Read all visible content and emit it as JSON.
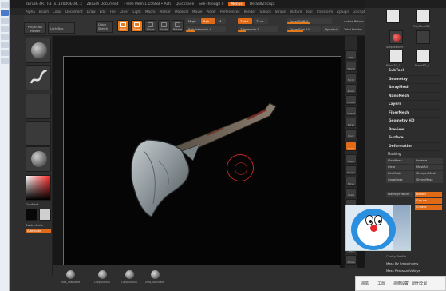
{
  "left_strip": {
    "items": 8
  },
  "titlebar": {
    "items": [
      "ZBrush 4R7 P3 [x11200QEO4...]",
      "ZBrush Document",
      "• Free Mem 1.156GB • Acti",
      "QuickSave",
      "See-through  0",
      "Menus",
      "DefaultZScript"
    ]
  },
  "menubar": {
    "items": [
      "Alpha",
      "Brush",
      "Color",
      "Document",
      "Draw",
      "Edit",
      "File",
      "Layer",
      "Light",
      "Macro",
      "Marker",
      "Material",
      "Movie",
      "Picker",
      "Preferences",
      "Render",
      "Stencil",
      "Stroke",
      "Texture",
      "Tool",
      "Transform",
      "Zplugin",
      "Zscript"
    ]
  },
  "toolbar": {
    "projection_master": "Projection Master",
    "lightbox": "LightBox",
    "quick_sketch": "Quick Sketch",
    "buttons": [
      "Edit",
      "Draw",
      "Move",
      "Scale",
      "Rotate"
    ],
    "mrgb": "Mrgb",
    "rgb": "Rgb",
    "m": "M",
    "rgb_intensity": "Rgb Intensity 4",
    "zadd": "Zadd",
    "zsub": "Zsub",
    "z_intensity": "Z Intensity 5",
    "focal_shift": "Focal Shift 0",
    "draw_size": "Draw Size 24",
    "dynamic": "Dynamic",
    "active_points": "Active Points:",
    "total_points": "Total Points:"
  },
  "left_shelf": {
    "gradient": "Gradient",
    "switch_color": "SwitchColor",
    "alternate": "Alternate"
  },
  "bottom_shelf": {
    "items": [
      "Zsss_Standard",
      "ClayBuildup",
      "ClayBuildup",
      "Zsss_Standard"
    ]
  },
  "right_shelf": {
    "buttons": [
      "BPR",
      "SPix 3",
      "Scroll",
      "Zoom",
      "Actual",
      "AAHalf",
      "Persp",
      "Floor",
      "Local",
      "LSym",
      "Frame",
      "Move",
      "Scale",
      "Rotate",
      "PolyF",
      "Transp",
      "Ghost",
      "Solo",
      "Xpose"
    ],
    "active": [
      "Local"
    ]
  },
  "tool_panel": {
    "top_labels": [
      "PolyMesh3D",
      "SimpleBrush",
      "Plane3D_1",
      "Plane3D_2"
    ],
    "menu": [
      "SubTool",
      "Geometry",
      "ArrayMesh",
      "NanoMesh",
      "Layers",
      "FiberMesh",
      "Geometry HD",
      "Preview",
      "Surface",
      "Deformation"
    ],
    "masking_header": "Masking",
    "masking_cells": [
      "ViewMask",
      "Inverse",
      "Clear",
      "MaskAll",
      "BlurMask",
      "SharpenMask",
      "GrowMask",
      "ShrinkMask"
    ],
    "mask_by_features": "MaskByFeature",
    "border": "Border",
    "groups": "Groups",
    "crease": "Crease",
    "cavity_profile": "Cavity Profile",
    "mask_smoothness": "Mask By Smoothness",
    "mask_peaks": "Mask PeaksAndValleys"
  },
  "ime_bar": {
    "items": [
      "画笔",
      "工具",
      "画面设置",
      "退出全屏"
    ]
  },
  "colors": {
    "accent": "#e06a16",
    "panel": "#2e2e2e",
    "viewport": "#050505"
  }
}
